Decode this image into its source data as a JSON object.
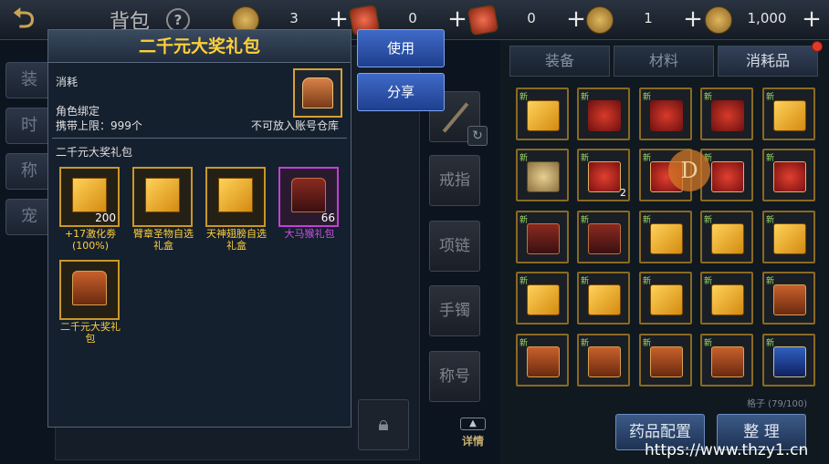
{
  "header": {
    "title": "背包",
    "back_icon": "back-arrow-icon",
    "currencies": [
      {
        "icon": "gold-coin-icon",
        "value": "3"
      },
      {
        "icon": "red-ticket-icon",
        "value": "0"
      },
      {
        "icon": "red-scroll-icon",
        "value": "0"
      },
      {
        "icon": "gold-token-icon",
        "value": "1"
      },
      {
        "icon": "gold-ingot-icon",
        "value": "1,000"
      }
    ]
  },
  "left_tabs": [
    "装",
    "时",
    "称",
    "宠"
  ],
  "equip_slots": [
    "戒指",
    "项链",
    "手镯",
    "称号"
  ],
  "inventory": {
    "tabs": [
      "装备",
      "材料",
      "消耗品"
    ],
    "active_tab": "消耗品",
    "slot_counter": "格子 (79/100)",
    "new_label": "新",
    "rows": [
      [
        {
          "type": "gift",
          "new": true,
          "count": ""
        },
        {
          "type": "bundle",
          "new": true,
          "count": ""
        },
        {
          "type": "bundle",
          "new": true,
          "count": ""
        },
        {
          "type": "bundle",
          "new": true,
          "count": ""
        },
        {
          "type": "gift",
          "new": true,
          "count": ""
        }
      ],
      [
        {
          "type": "coin",
          "new": true,
          "count": ""
        },
        {
          "type": "pouch",
          "new": true,
          "count": "2"
        },
        {
          "type": "pouch",
          "new": true,
          "count": ""
        },
        {
          "type": "pouch",
          "new": true,
          "count": ""
        },
        {
          "type": "pouch",
          "new": true,
          "count": ""
        }
      ],
      [
        {
          "type": "redchest",
          "new": true,
          "count": ""
        },
        {
          "type": "redchest",
          "new": true,
          "count": ""
        },
        {
          "type": "gift",
          "new": true,
          "count": ""
        },
        {
          "type": "gift",
          "new": true,
          "count": ""
        },
        {
          "type": "gift",
          "new": true,
          "count": ""
        }
      ],
      [
        {
          "type": "gift",
          "new": true,
          "count": ""
        },
        {
          "type": "gift",
          "new": true,
          "count": ""
        },
        {
          "type": "gift",
          "new": true,
          "count": ""
        },
        {
          "type": "gift",
          "new": true,
          "count": ""
        },
        {
          "type": "chest",
          "new": true,
          "count": ""
        }
      ],
      [
        {
          "type": "chest",
          "new": true,
          "count": ""
        },
        {
          "type": "chest",
          "new": true,
          "count": ""
        },
        {
          "type": "chest",
          "new": true,
          "count": ""
        },
        {
          "type": "chest",
          "new": true,
          "count": ""
        },
        {
          "type": "vase",
          "new": true,
          "count": ""
        }
      ]
    ],
    "floating_badge": "D",
    "buttons": {
      "potion": "药品配置",
      "sort": "整 理"
    }
  },
  "actions": {
    "use": "使用",
    "share": "分享"
  },
  "detail_label": "详情",
  "tooltip": {
    "title": "二千元大奖礼包",
    "type": "消耗",
    "bind": "角色绑定",
    "limit": "携带上限：999个",
    "storage": "不可放入账号仓库",
    "contents_label": "二千元大奖礼包",
    "rewards": [
      {
        "name": "+17激化劵(100%)",
        "count": "200",
        "kind": "gift",
        "rarity": "gold"
      },
      {
        "name": "臂章圣物自选礼盒",
        "count": "",
        "kind": "gift",
        "rarity": "gold"
      },
      {
        "name": "天神翅膀自选礼盒",
        "count": "",
        "kind": "gift",
        "rarity": "gold"
      },
      {
        "name": "大马猴礼包",
        "count": "66",
        "kind": "redchest",
        "rarity": "purple"
      },
      {
        "name": "二千元大奖礼包",
        "count": "",
        "kind": "chest",
        "rarity": "gold"
      }
    ]
  },
  "watermark": "https://www.thzy1.cn",
  "colors": {
    "title_gold": "#ffcf3a",
    "rare_purple": "#d050e8",
    "button_blue": "#2f55b0"
  }
}
